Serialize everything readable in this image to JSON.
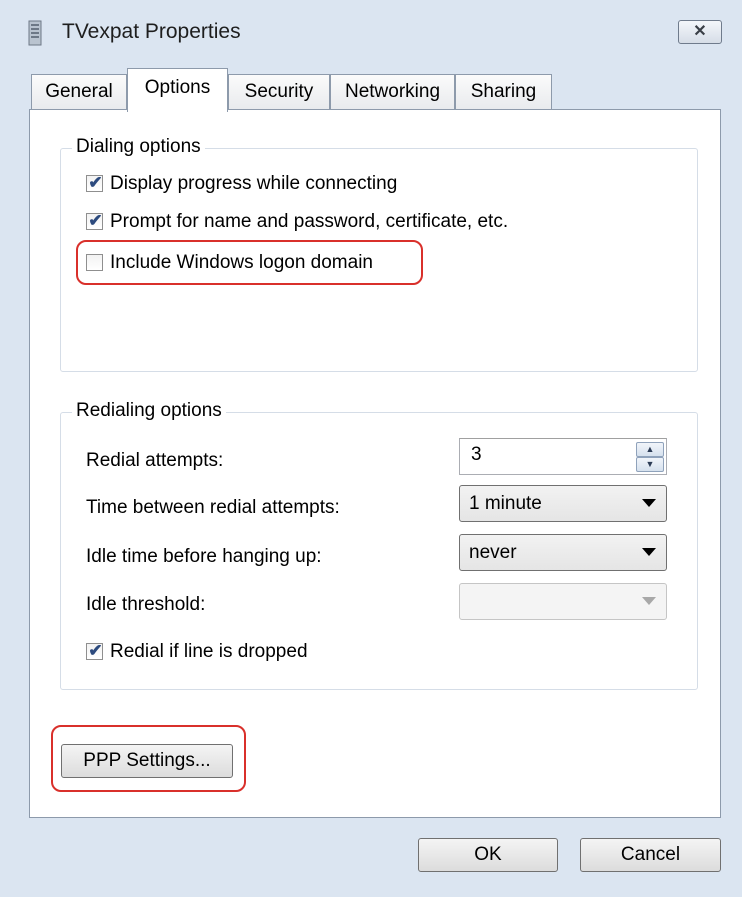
{
  "window": {
    "title": "TVexpat Properties",
    "close_label": "✕"
  },
  "tabs": [
    {
      "label": "General",
      "active": false
    },
    {
      "label": "Options",
      "active": true
    },
    {
      "label": "Security",
      "active": false
    },
    {
      "label": "Networking",
      "active": false
    },
    {
      "label": "Sharing",
      "active": false
    }
  ],
  "dialing": {
    "group_label": "Dialing options",
    "options": [
      {
        "label": "Display progress while connecting",
        "checked": true
      },
      {
        "label": "Prompt for name and password, certificate, etc.",
        "checked": true
      },
      {
        "label": "Include Windows logon domain",
        "checked": false
      }
    ]
  },
  "redialing": {
    "group_label": "Redialing options",
    "redial_attempts_label": "Redial attempts:",
    "redial_attempts_value": "3",
    "time_between_label": "Time between redial attempts:",
    "time_between_value": "1 minute",
    "idle_time_label": "Idle time before hanging up:",
    "idle_time_value": "never",
    "idle_threshold_label": "Idle threshold:",
    "idle_threshold_value": "",
    "redial_if_dropped_label": "Redial if line is dropped",
    "redial_if_dropped_checked": true
  },
  "buttons": {
    "ppp_settings": "PPP Settings...",
    "ok": "OK",
    "cancel": "Cancel"
  },
  "marks": {
    "check": "✔",
    "spin_up": "▲",
    "spin_down": "▼"
  },
  "colors": {
    "highlight": "#d9302b",
    "window_bg": "#dbe5f1"
  }
}
